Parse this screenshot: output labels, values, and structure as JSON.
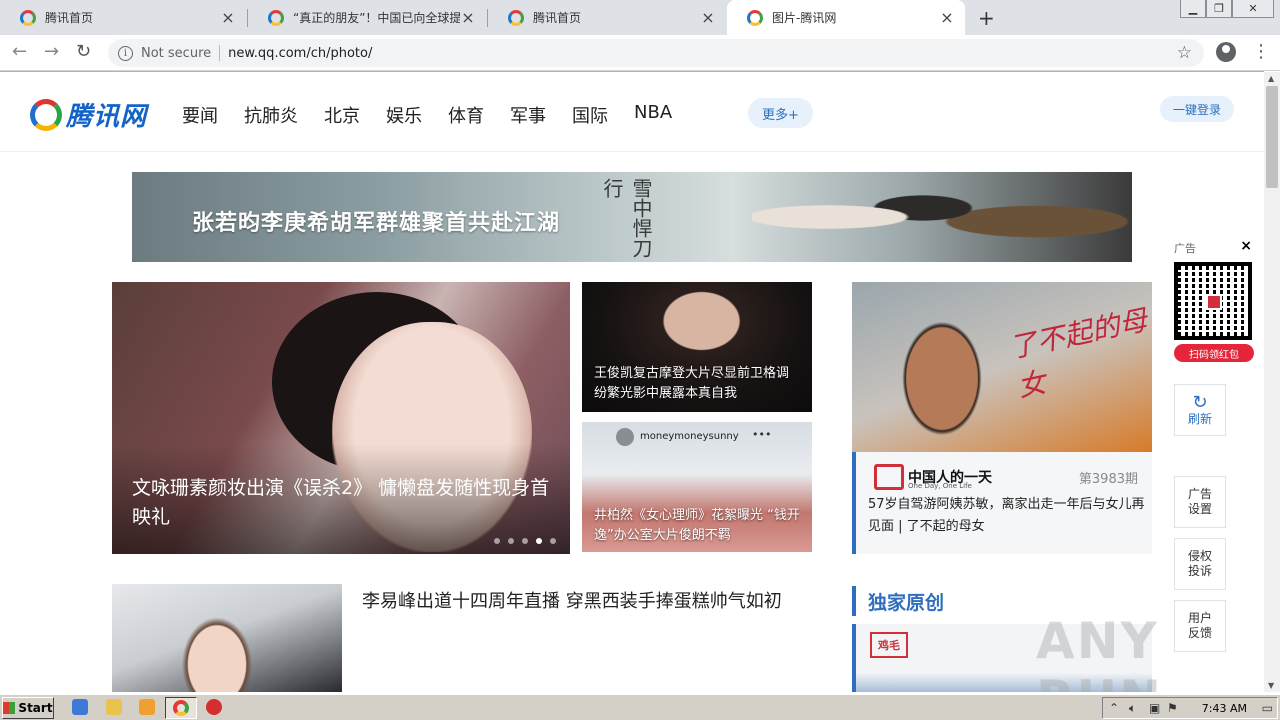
{
  "browser": {
    "tabs": [
      {
        "title": "腾讯首页",
        "active": false
      },
      {
        "title": "“真正的朋友”！中国已向全球提供…",
        "active": false
      },
      {
        "title": "腾讯首页",
        "active": false
      },
      {
        "title": "图片-腾讯网",
        "active": true
      }
    ],
    "tab_close": "×",
    "new_tab": "+",
    "security": "Not secure",
    "url": "new.qq.com/ch/photo/"
  },
  "site": {
    "logo": "腾讯网",
    "nav": [
      "要闻",
      "抗肺炎",
      "北京",
      "娱乐",
      "体育",
      "军事",
      "国际",
      "NBA"
    ],
    "more": "更多+",
    "login": "一键登录"
  },
  "banner": {
    "headline": "张若昀李庚希胡军群雄聚首共赴江湖",
    "calligraphy": "雪中悍刀行"
  },
  "hero": {
    "caption": "文咏珊素颜妆出演《误杀2》 慵懒盘发随性现身首映礼",
    "slides": 5,
    "active_slide": 4
  },
  "cards": [
    {
      "caption": "王俊凯复古摩登大片尽显前卫格调 纷繁光影中展露本真自我"
    },
    {
      "handle": "moneymoneysunny",
      "more": "•••",
      "caption": "井柏然《女心理师》花絮曝光 “钱开逸”办公室大片俊朗不羁"
    }
  ],
  "right_story": {
    "script": "了不起的母女",
    "brand": "中国人的一天",
    "brand_sub": "One Day, One Life",
    "issue": "第3983期",
    "text": "57岁自驾游阿姨苏敏，离家出走一年后与女儿再见面 | 了不起的母女"
  },
  "list_item": {
    "title": "李易峰出道十四周年直播 穿黑西装手捧蛋糕帅气如初"
  },
  "section": {
    "title": "独家原创",
    "promo_logo": "鸡毛"
  },
  "float_ad": {
    "label": "广告",
    "close": "×",
    "cta": "扫码领红包"
  },
  "side_buttons": {
    "refresh_icon": "↻",
    "refresh": "刷新",
    "ad_settings": "广告设置",
    "report": "侵权投诉",
    "feedback": "用户反馈"
  },
  "watermark": "ANY RUN",
  "taskbar": {
    "start": "Start",
    "clock": "7:43 AM"
  }
}
